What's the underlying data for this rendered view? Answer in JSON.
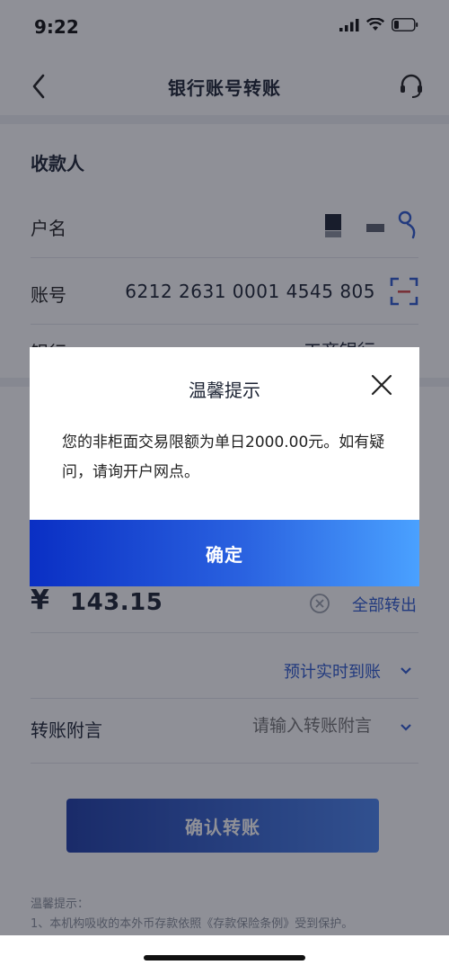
{
  "status_bar": {
    "time": "9:22"
  },
  "nav": {
    "title": "银行账号转账"
  },
  "payee": {
    "section_title": "收款人",
    "name_label": "户名",
    "account_label": "账号",
    "account_number": "6212 2631 0001 4545 805",
    "bank_label": "银行",
    "bank_value": "工商银行"
  },
  "amount": {
    "currency_symbol": "¥",
    "value": "143.15",
    "transfer_all_label": "全部转出"
  },
  "arrival": {
    "label": "预计实时到账"
  },
  "memo": {
    "label": "转账附言",
    "placeholder": "请输入转账附言"
  },
  "confirm_button": {
    "label": "确认转账"
  },
  "footer": {
    "tip_title": "温馨提示：",
    "tip_line_1": "1、本机构吸收的本外币存款依照《存款保险条例》受到保护。"
  },
  "dialog": {
    "title": "温馨提示",
    "message": "您的非柜面交易限额为单日2000.00元。如有疑问，请询开户网点。",
    "ok_label": "确定"
  },
  "colors": {
    "accent": "#2f5bd0",
    "dialog_button_start": "#0a2fc4",
    "dialog_button_end": "#4aa1ff"
  }
}
